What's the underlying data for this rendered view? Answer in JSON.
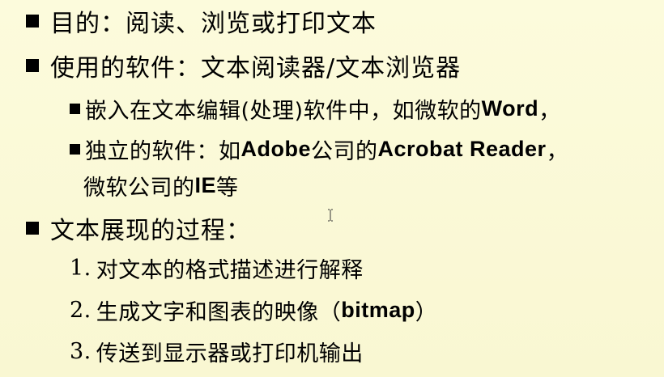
{
  "bullets": {
    "purpose": "目的：阅读、浏览或打印文本",
    "software": "使用的软件：文本阅读器/文本浏览器",
    "embedded": {
      "prefix": "嵌入在文本编辑(处理)软件中，如微软的",
      "brand": "Word",
      "suffix": "，"
    },
    "standalone": {
      "prefix": "独立的软件：如",
      "brand1": "Adobe",
      "mid": "公司的",
      "brand2": "Acrobat Reader",
      "suffix": "，"
    },
    "standalone_cont": {
      "prefix": "微软公司的",
      "brand": "IE",
      "suffix": "等"
    },
    "process": "文本展现的过程：",
    "steps": [
      {
        "num": "1.",
        "text": "对文本的格式描述进行解释"
      },
      {
        "num": "2.",
        "text_prefix": "生成文字和图表的映像（",
        "latin": "bitmap",
        "text_suffix": "）"
      },
      {
        "num": "3.",
        "text": "传送到显示器或打印机输出"
      }
    ]
  },
  "cursor_icon": "text-cursor-icon"
}
